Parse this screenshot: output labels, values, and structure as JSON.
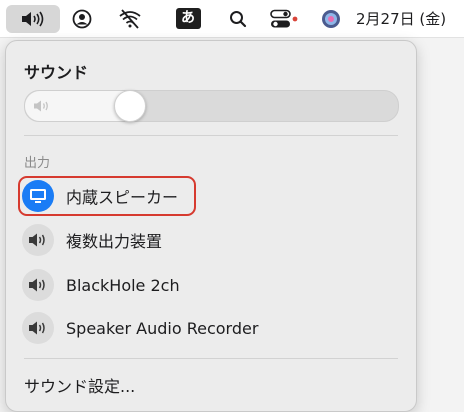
{
  "menubar": {
    "sound_icon": "speaker-icon",
    "user_icon": "user-circle-icon",
    "wifi_icon": "wifi-off-icon",
    "ime_label": "あ",
    "search_icon": "search-icon",
    "control_center_icon": "control-center-icon",
    "siri_icon": "siri-icon",
    "clock": "2月27日 (金)"
  },
  "sound_panel": {
    "title": "サウンド",
    "volume_level": 0.26,
    "output_section_label": "出力",
    "devices": [
      {
        "label": "内蔵スピーカー",
        "icon": "display-icon",
        "selected": true
      },
      {
        "label": "複数出力装置",
        "icon": "speaker-icon",
        "selected": false
      },
      {
        "label": "BlackHole 2ch",
        "icon": "speaker-icon",
        "selected": false
      },
      {
        "label": "Speaker Audio Recorder",
        "icon": "speaker-icon",
        "selected": false
      }
    ],
    "settings_label": "サウンド設定..."
  },
  "colors": {
    "accent": "#1a7cf5",
    "highlight_border": "#d63a2f"
  }
}
